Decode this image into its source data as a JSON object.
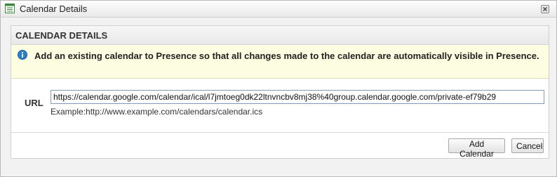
{
  "window": {
    "title": "Calendar Details",
    "icons": {
      "app": "calendar-list-icon",
      "close": "close-icon"
    }
  },
  "panel": {
    "title": "CALENDAR DETAILS",
    "info_icon": "info-icon",
    "info_text": "Add an existing calendar to Presence so that all changes made to the calendar are automatically visible in Presence."
  },
  "form": {
    "url_label": "URL",
    "url_value": "https://calendar.google.com/calendar/ical/l7jmtoeg0dk22ltnvncbv8mj38%40group.calendar.google.com/private-ef79b29",
    "example": "Example:http://www.example.com/calendars/calendar.ics"
  },
  "buttons": {
    "add": "Add Calendar",
    "cancel": "Cancel"
  },
  "colors": {
    "info_background": "#fdfde1",
    "info_icon": "#2f7fc8",
    "title_icon": "#3b8a3b"
  }
}
